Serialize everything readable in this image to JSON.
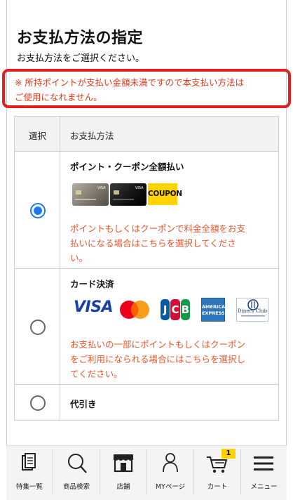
{
  "header": {
    "title": "お支払方法の指定",
    "subtitle": "お支払方法をご選択ください。"
  },
  "notice": {
    "line1": "※ 所持ポイントが支払い金額未満ですので本支払い方法は",
    "line2": "ご使用になれません。",
    "color": "#e02020"
  },
  "table": {
    "col_select": "選択",
    "col_method": "お支払方法",
    "options": [
      {
        "title": "ポイント・クーポン全額払い",
        "selected": true,
        "coupon_label": "COUPON",
        "desc_lines": [
          "ポイントもしくはクーポンで料金全額をお支",
          "払いになる場合はこちらを選択してくださ",
          "い。"
        ]
      },
      {
        "title": "カード決済",
        "selected": false,
        "brands": {
          "visa": "VISA",
          "jcb": [
            "J",
            "C",
            "B"
          ],
          "amex": [
            "AMERICAN",
            "EXPRESS"
          ],
          "diners": "Diners Club"
        },
        "desc_lines": [
          "お支払いの一部にポイントもしくはクーポン",
          "をご利用になられる場合にはこちらを選択し",
          "てください。"
        ]
      },
      {
        "title": "代引き",
        "selected": false
      }
    ]
  },
  "nav": {
    "items": [
      {
        "label": "特集一覧",
        "icon": "book-stack-icon"
      },
      {
        "label": "商品検索",
        "icon": "search-icon"
      },
      {
        "label": "店舗",
        "icon": "store-icon"
      },
      {
        "label": "MYページ",
        "icon": "user-icon"
      },
      {
        "label": "カート",
        "icon": "cart-icon"
      },
      {
        "label": "メニュー",
        "icon": "hamburger-menu-icon"
      }
    ],
    "cart_count": "1"
  },
  "colors": {
    "accent_blue": "#1e78f0",
    "warning_red": "#e02020",
    "desc_orange": "#e8542c",
    "badge_yellow": "#ffcf00"
  }
}
